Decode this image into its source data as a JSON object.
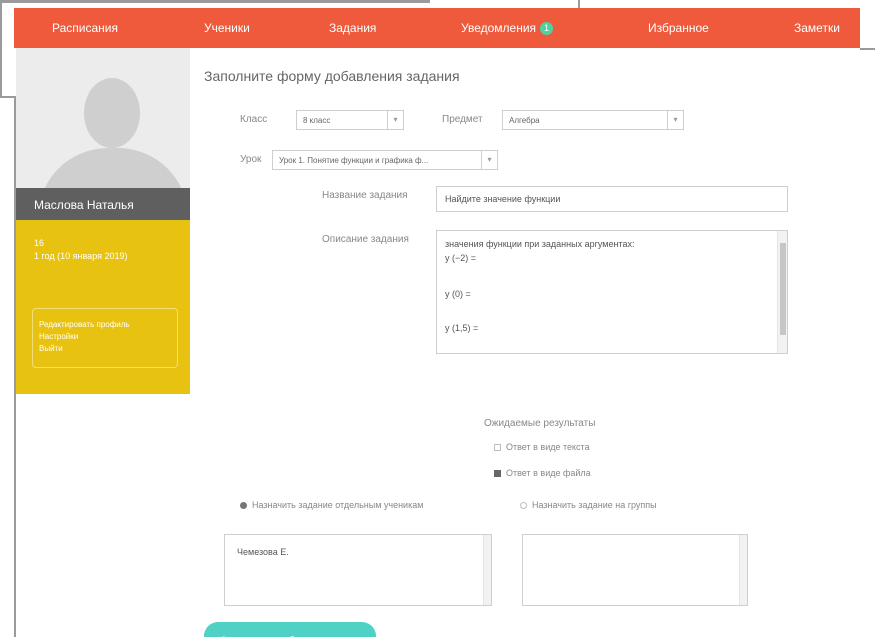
{
  "nav": {
    "items": [
      "Расписания",
      "Ученики",
      "Задания",
      "Уведомления",
      "Избранное",
      "Заметки"
    ],
    "notifications_badge": "1"
  },
  "profile": {
    "name": "Маслова Наталья",
    "line1": "16",
    "line2": "1 год (10 января 2019)",
    "menu": [
      "Редактировать профиль",
      "Настройки",
      "Выйти"
    ]
  },
  "form": {
    "title": "Заполните форму добавления задания",
    "class_label": "Класс",
    "class_value": "8 класс",
    "subject_label": "Предмет",
    "subject_value": "Алгебра",
    "lesson_label": "Урок",
    "lesson_value": "Урок 1. Понятие функции и графика ф...",
    "task_name_label": "Название задания",
    "task_name_value": "Найдите значение функции",
    "description_label": "Описание задания",
    "description_lines": [
      "значения функции при заданных аргументах:",
      "y (−2) =",
      "y (0) =",
      "y (1,5) ="
    ],
    "expected_label": "Ожидаемые результаты",
    "answer_text_label": "Ответ в виде текста",
    "answer_file_label": "Ответ в виде файла",
    "assign_students_label": "Назначить задание отдельным ученикам",
    "assign_groups_label": "Назначить задание на группы",
    "students_value": "Чемезова Е.",
    "save_label": "Сохранить и опубликовать"
  },
  "colors": {
    "nav_bg": "#ef5a3c",
    "sidebar_yellow": "#e8c210",
    "name_bar": "#5f5f5f",
    "save_button": "#4fd1c5",
    "badge": "#4fd1a0"
  }
}
